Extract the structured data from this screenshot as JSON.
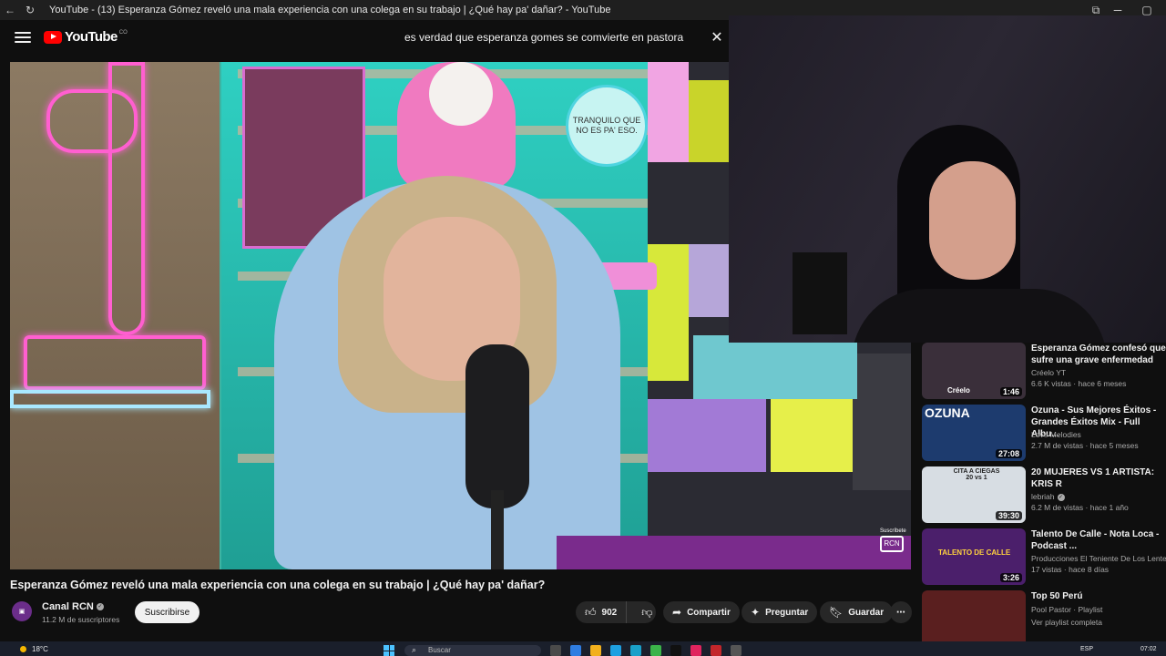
{
  "browser": {
    "title": "YouTube - (13) Esperanza Gómez reveló una mala experiencia con una colega en su trabajo | ¿Qué hay pa' dañar? - YouTube",
    "back_icon": "arrow-left-icon",
    "reload_icon": "reload-icon",
    "window_controls": [
      "─",
      "▢"
    ]
  },
  "header": {
    "logo_text": "YouTube",
    "logo_country": "CO",
    "search_value": "es verdad que esperanza gomes se comvierte en pastora",
    "clear_icon": "close-icon"
  },
  "video": {
    "bubble_text": "TRANQUILO QUE NO ES PA' ESO.",
    "watermark": "RCN",
    "watermark_caption": "Suscríbete",
    "title": "Esperanza Gómez reveló una mala experiencia con una colega en su trabajo | ¿Qué hay pa' dañar?"
  },
  "channel": {
    "name": "Canal RCN",
    "subscribers": "11.2 M de suscriptores",
    "subscribe_label": "Suscribirse"
  },
  "actions": {
    "likes": "902",
    "share_label": "Compartir",
    "ask_label": "Preguntar",
    "save_label": "Guardar",
    "more_icon": "more-icon"
  },
  "recommendations": [
    {
      "title": "Esperanza Gómez confesó que sufre una grave enfermedad",
      "channel": "Créelo YT",
      "meta": "6.6 K vistas · hace 6 meses",
      "duration": "1:46",
      "thumb_text": "Créelo",
      "thumb_color": "#3a2f3a"
    },
    {
      "title": "Ozuna - Sus Mejores Éxitos - Grandes Éxitos Mix - Full Albu...",
      "channel": "Love Melodies",
      "meta": "2.7 M de vistas · hace 5 meses",
      "duration": "27:08",
      "thumb_text": "OZUNA",
      "thumb_color": "#1d3b6e"
    },
    {
      "title": "20 MUJERES VS 1 ARTISTA: KRIS R",
      "channel": "lebriah",
      "verified": true,
      "meta": "6.2 M de vistas · hace 1 año",
      "duration": "39:30",
      "thumb_text": "CITA A CIEGAS 20 vs 1",
      "thumb_color": "#d7dde3"
    },
    {
      "title": "Talento De Calle - Nota Loca - Podcast ...",
      "channel": "Producciones El Teniente De Los Lentes",
      "meta": "17 vistas · hace 8 días",
      "duration": "3:26",
      "thumb_text": "TALENTO DE CALLE",
      "thumb_color": "#4b1f6b"
    },
    {
      "title": "Top 50 Perú",
      "channel": "Pool Pastor · Playlist",
      "meta": "Ver playlist completa",
      "duration": "",
      "thumb_text": "",
      "thumb_color": "#5a1f1f"
    }
  ],
  "taskbar": {
    "temperature": "18°C",
    "search_placeholder": "Buscar",
    "language": "ESP",
    "time": "07:02"
  }
}
